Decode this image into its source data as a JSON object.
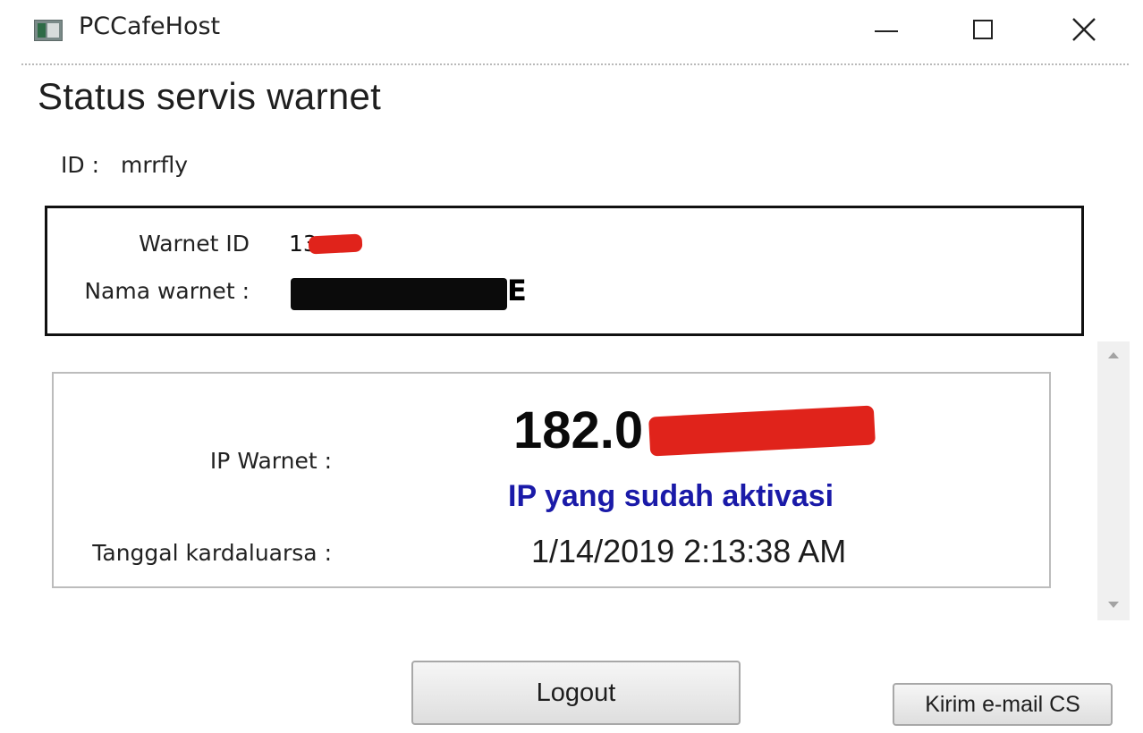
{
  "window": {
    "title": "PCCafeHost"
  },
  "page": {
    "title": "Status servis warnet"
  },
  "user": {
    "label": "ID :",
    "value": "mrrfly"
  },
  "warnet_info": {
    "id_label": "Warnet ID",
    "id_value_visible": "13",
    "name_label": "Nama warnet :",
    "name_value_visible": "E"
  },
  "status": {
    "ip_label": "IP Warnet :",
    "ip_value_visible": "182.0",
    "ip_status": "IP yang sudah aktivasi",
    "ip_status_color": "#1a1aa8",
    "expiry_label": "Tanggal kardaluarsa :",
    "expiry_value": "1/14/2019 2:13:38 AM"
  },
  "buttons": {
    "logout": "Logout",
    "email_cs": "Kirim e-mail CS"
  },
  "icons": {
    "app": "app-window-icon",
    "minimize": "minimize-icon",
    "maximize": "maximize-icon",
    "close": "close-icon",
    "scroll_up": "scroll-up-arrow-icon",
    "scroll_down": "scroll-down-arrow-icon"
  },
  "redaction_colors": {
    "red": "#e0231b",
    "black": "#0b0b0b"
  }
}
